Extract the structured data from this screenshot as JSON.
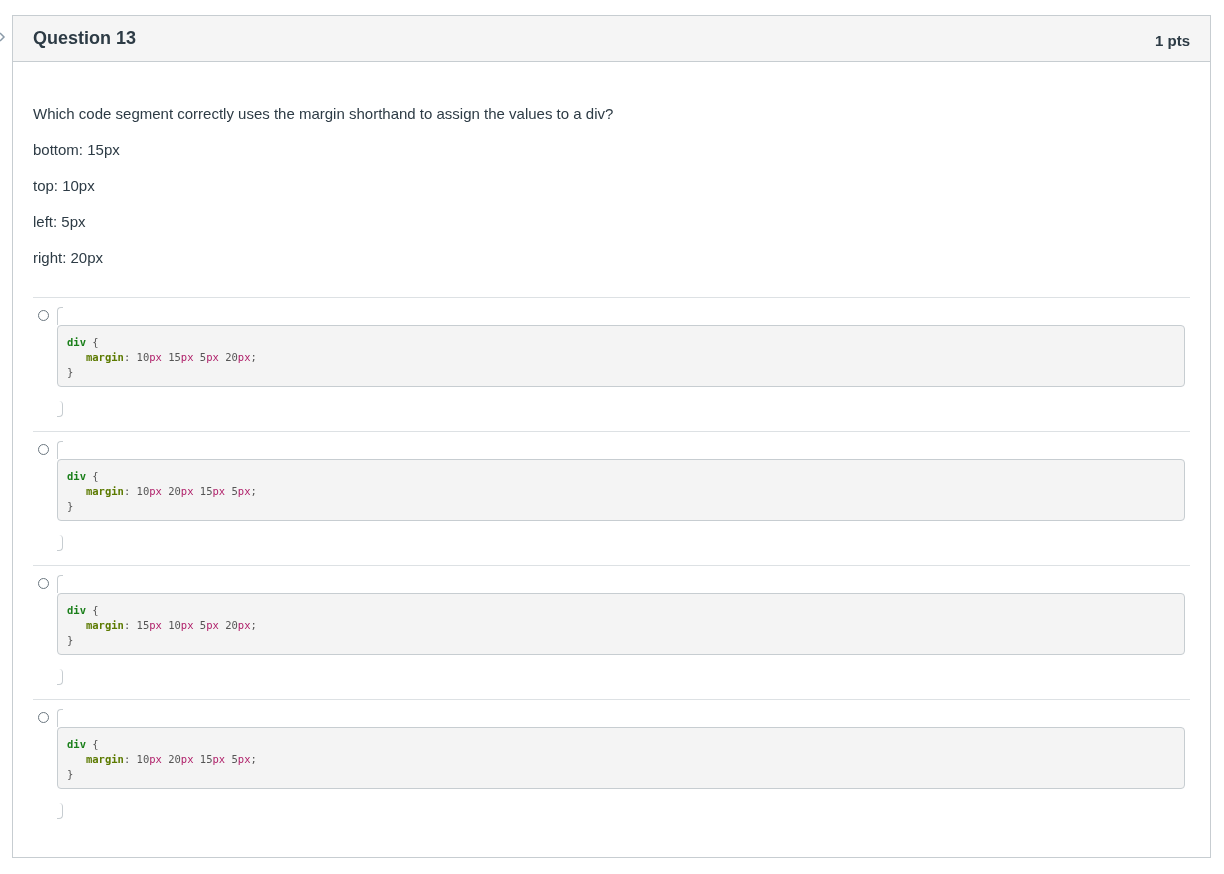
{
  "question": {
    "title": "Question 13",
    "points": "1 pts",
    "text": "Which code segment correctly uses the margin shorthand to assign the values to a div?",
    "values": [
      "bottom: 15px",
      "top: 10px",
      "left: 5px",
      "right: 20px"
    ]
  },
  "answers": [
    {
      "selected": false,
      "code": {
        "selector": "div",
        "open": "{",
        "property": "margin",
        "colon": ":",
        "values": [
          {
            "number": "10",
            "unit": "px"
          },
          {
            "number": "15",
            "unit": "px"
          },
          {
            "number": "5",
            "unit": "px"
          },
          {
            "number": "20",
            "unit": "px"
          }
        ],
        "end": ";",
        "close": "}"
      }
    },
    {
      "selected": false,
      "code": {
        "selector": "div",
        "open": "{",
        "property": "margin",
        "colon": ":",
        "values": [
          {
            "number": "10",
            "unit": "px"
          },
          {
            "number": "20",
            "unit": "px"
          },
          {
            "number": "15",
            "unit": "px"
          },
          {
            "number": "5",
            "unit": "px"
          }
        ],
        "end": ";",
        "close": "}"
      }
    },
    {
      "selected": false,
      "code": {
        "selector": "div",
        "open": "{",
        "property": "margin",
        "colon": ":",
        "values": [
          {
            "number": "15",
            "unit": "px"
          },
          {
            "number": "10",
            "unit": "px"
          },
          {
            "number": "5",
            "unit": "px"
          },
          {
            "number": "20",
            "unit": "px"
          }
        ],
        "end": ";",
        "close": "}"
      }
    },
    {
      "selected": false,
      "code": {
        "selector": "div",
        "open": "{",
        "property": "margin",
        "colon": ":",
        "values": [
          {
            "number": "10",
            "unit": "px"
          },
          {
            "number": "20",
            "unit": "px"
          },
          {
            "number": "15",
            "unit": "px"
          },
          {
            "number": "5",
            "unit": "px"
          }
        ],
        "end": ";",
        "close": "}"
      }
    }
  ]
}
